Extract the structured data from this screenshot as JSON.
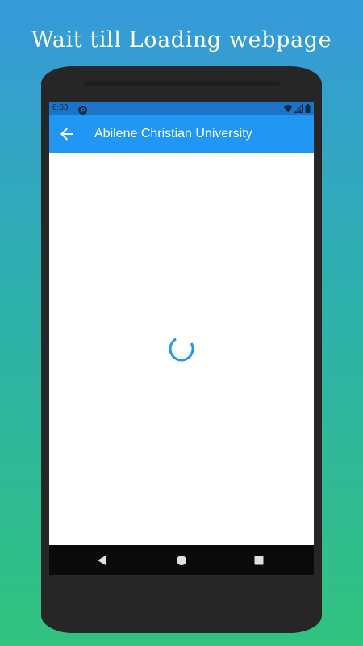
{
  "banner": {
    "headline": "Wait till Loading webpage"
  },
  "status_bar": {
    "time": "6:03",
    "icons": [
      "app-notification-icon",
      "wifi-icon",
      "cellular-signal-icon",
      "battery-icon"
    ]
  },
  "app_bar": {
    "title": "Abilene Christian University",
    "back_icon": "arrow-back-icon"
  },
  "content": {
    "state": "loading",
    "spinner_icon": "loading-spinner-icon"
  },
  "nav_bar": {
    "icons": [
      "nav-back-triangle-icon",
      "nav-home-circle-icon",
      "nav-recents-square-icon"
    ]
  },
  "colors": {
    "background_top": "#3699db",
    "background_bottom": "#31c37f",
    "status_bar": "#1c74c9",
    "app_bar": "#2196f3",
    "spinner": "#2196f3",
    "phone_body": "#262626",
    "nav_bar": "#0a0a0a"
  }
}
